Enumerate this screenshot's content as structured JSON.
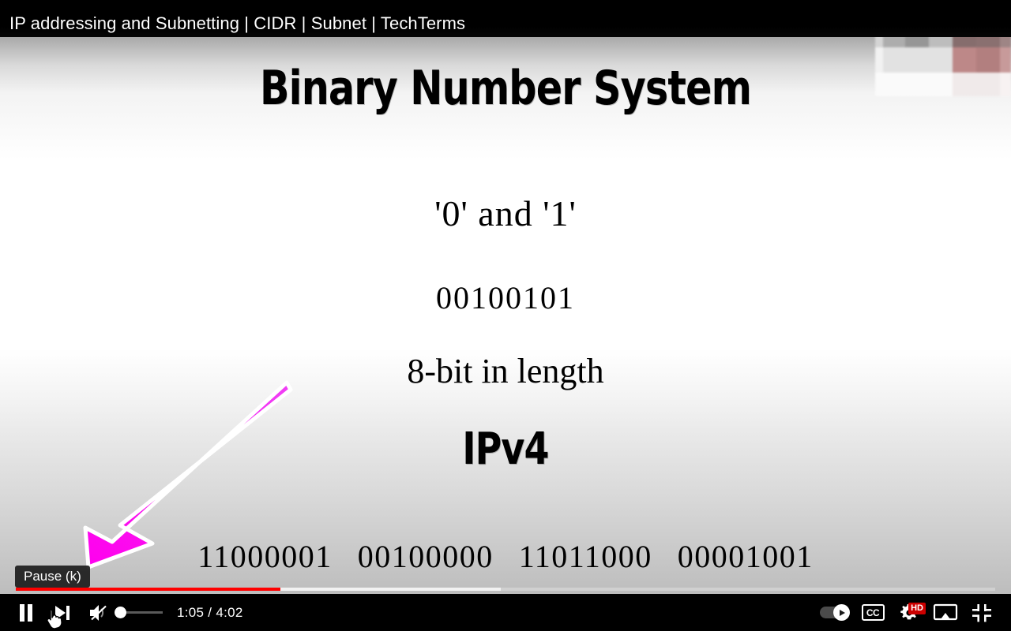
{
  "title_bar": {
    "video_title": "IP addressing and Subnetting | CIDR | Subnet | TechTerms"
  },
  "slide": {
    "title": "Binary Number System",
    "digits_line": "'0' and '1'",
    "binary_example": "00100101",
    "bit_length_line": "8-bit in length",
    "ip_version": "IPv4",
    "octets": [
      "11000001",
      "00100000",
      "11011000",
      "00001001"
    ]
  },
  "tooltip": {
    "label": "Pause (k)"
  },
  "controls": {
    "pause_label": "Pause",
    "next_label": "Next",
    "mute_label": "Unmute",
    "volume_label": "Volume",
    "time_current": "1:05",
    "time_separator": "/",
    "time_total": "4:02",
    "time_display": "1:05 / 4:02",
    "autoplay_label": "Autoplay is on",
    "subtitles_label": "CC",
    "settings_label": "Settings",
    "quality_badge": "HD",
    "cast_label": "Play on TV",
    "exit_fullscreen_label": "Exit full screen"
  },
  "progress": {
    "played_percent": 27,
    "loaded_percent": 49.5
  },
  "icons": {
    "pause": "pause-icon",
    "next": "next-video-icon",
    "mute": "volume-muted-icon",
    "autoplay": "autoplay-toggle-icon",
    "subtitles": "closed-captions-icon",
    "settings": "gear-icon",
    "cast": "cast-to-tv-icon",
    "exit_fullscreen": "exit-fullscreen-icon",
    "cursor": "pointer-hand-cursor",
    "annotation": "magenta-arrow-annotation"
  },
  "colors": {
    "progress_played": "#ff0000",
    "hd_badge": "#cc0000",
    "annotation_arrow": "#ff00e6",
    "control_bar": "#000000"
  }
}
